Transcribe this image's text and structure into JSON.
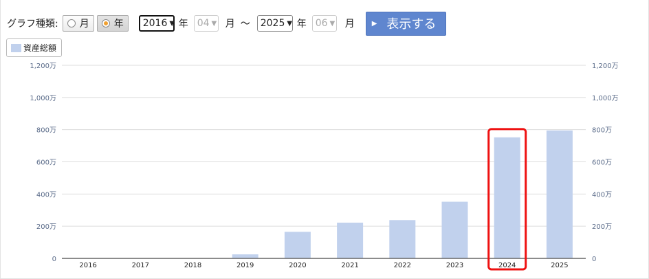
{
  "controls": {
    "graph_type_label": "グラフ種類:",
    "radio_month_label": "月",
    "radio_year_label": "年",
    "start_year": "2016",
    "start_year_unit": "年",
    "start_month": "04",
    "start_month_unit": "月",
    "range_separator": "～",
    "end_year": "2025",
    "end_year_unit": "年",
    "end_month": "06",
    "end_month_unit": "月",
    "show_button_label": "表示する"
  },
  "legend": {
    "label": "資産総額",
    "color": "#c1d1ed"
  },
  "highlight_color": "#ee1111",
  "chart_data": {
    "type": "bar",
    "categories": [
      "2016",
      "2017",
      "2018",
      "2019",
      "2020",
      "2021",
      "2022",
      "2023",
      "2024",
      "2025"
    ],
    "series": [
      {
        "name": "資産総額",
        "values": [
          0,
          0,
          0,
          25,
          165,
          222,
          238,
          352,
          752,
          795
        ]
      }
    ],
    "ylim": [
      0,
      1200
    ],
    "yticks": [
      0,
      200,
      400,
      600,
      800,
      1000,
      1200
    ],
    "ytick_labels": [
      "0",
      "200万",
      "400万",
      "600万",
      "800万",
      "1,000万",
      "1,200万"
    ],
    "y_unit": "万円",
    "bar_color": "#c1d1ed",
    "grid": true,
    "highlighted_category": "2024"
  }
}
